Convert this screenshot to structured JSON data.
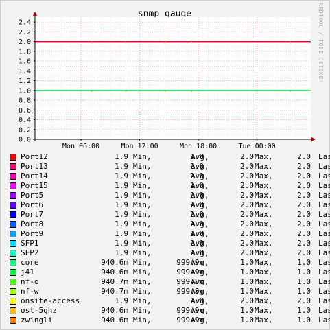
{
  "chart_data": {
    "type": "line",
    "title": "snmp gauge",
    "watermark": "RRDTOOL / TOBI OETIKER",
    "y_ticks": [
      "0.0",
      "0.2",
      "0.4",
      "0.6",
      "0.8",
      "1.0",
      "1.2",
      "1.4",
      "1.6",
      "1.8",
      "2.0",
      "2.2",
      "2.4"
    ],
    "ylim": [
      0,
      2.5
    ],
    "x_ticks": [
      "Mon 06:00",
      "Mon 12:00",
      "Mon 18:00",
      "Tue 00:00"
    ],
    "x_tick_values": [
      6,
      12,
      18,
      24
    ],
    "xlim": [
      1.3,
      29.5
    ],
    "grid": true,
    "series": [
      {
        "name": "Port12",
        "color": "#ff0000",
        "value": 2.0,
        "min": "1.9",
        "avg": "2.0",
        "max": "2.0",
        "last": "2.0"
      },
      {
        "name": "Port13",
        "color": "#ff0080",
        "value": 2.0,
        "min": "1.9",
        "avg": "2.0",
        "max": "2.0",
        "last": "2.0"
      },
      {
        "name": "Port14",
        "color": "#ff00b0",
        "value": 2.0,
        "min": "1.9",
        "avg": "2.0",
        "max": "2.0",
        "last": "2.0"
      },
      {
        "name": "Port15",
        "color": "#ff00ff",
        "value": 2.0,
        "min": "1.9",
        "avg": "2.0",
        "max": "2.0",
        "last": "2.0"
      },
      {
        "name": "Port5",
        "color": "#a000ff",
        "value": 2.0,
        "min": "1.9",
        "avg": "2.0",
        "max": "2.0",
        "last": "2.0"
      },
      {
        "name": "Port6",
        "color": "#6000ff",
        "value": 2.0,
        "min": "1.9",
        "avg": "2.0",
        "max": "2.0",
        "last": "2.0"
      },
      {
        "name": "Port7",
        "color": "#0000ff",
        "value": 2.0,
        "min": "1.9",
        "avg": "2.0",
        "max": "2.0",
        "last": "2.0"
      },
      {
        "name": "Port8",
        "color": "#0060ff",
        "value": 2.0,
        "min": "1.9",
        "avg": "2.0",
        "max": "2.0",
        "last": "2.0"
      },
      {
        "name": "Port9",
        "color": "#00a0ff",
        "value": 2.0,
        "min": "1.9",
        "avg": "2.0",
        "max": "2.0",
        "last": "2.0"
      },
      {
        "name": "SFP1",
        "color": "#00e0ff",
        "value": 2.0,
        "min": "1.9",
        "avg": "2.0",
        "max": "2.0",
        "last": "2.0"
      },
      {
        "name": "SFP2",
        "color": "#00ffc0",
        "value": 2.0,
        "min": "1.9",
        "avg": "2.0",
        "max": "2.0",
        "last": "2.0"
      },
      {
        "name": "core",
        "color": "#00ff80",
        "value": 1.0,
        "min": "940.6m",
        "avg": "999.9m",
        "max": "1.0",
        "last": "1.0"
      },
      {
        "name": "j41",
        "color": "#00ff40",
        "value": 1.0,
        "min": "940.6m",
        "avg": "999.9m",
        "max": "1.0",
        "last": "1.0"
      },
      {
        "name": "nf-o",
        "color": "#40ff00",
        "value": 1.0,
        "min": "940.7m",
        "avg": "999.8m",
        "max": "1.0",
        "last": "1.0"
      },
      {
        "name": "nf-w",
        "color": "#a0ff00",
        "value": 1.0,
        "min": "940.7m",
        "avg": "999.8m",
        "max": "1.0",
        "last": "1.0"
      },
      {
        "name": "onsite-access",
        "color": "#ffff00",
        "value": 2.0,
        "min": "1.9",
        "avg": "2.0",
        "max": "2.0",
        "last": "2.0"
      },
      {
        "name": "ost-5ghz",
        "color": "#ffc000",
        "value": 1.0,
        "min": "940.6m",
        "avg": "999.9m",
        "max": "1.0",
        "last": "1.0"
      },
      {
        "name": "zwingli",
        "color": "#ff8000",
        "value": 1.0,
        "min": "940.6m",
        "avg": "999.9m",
        "max": "1.0",
        "last": "1.0"
      }
    ]
  },
  "legend_labels": {
    "min": "Min,",
    "avg": "Avg,",
    "max": "Max,",
    "last": "Las"
  }
}
